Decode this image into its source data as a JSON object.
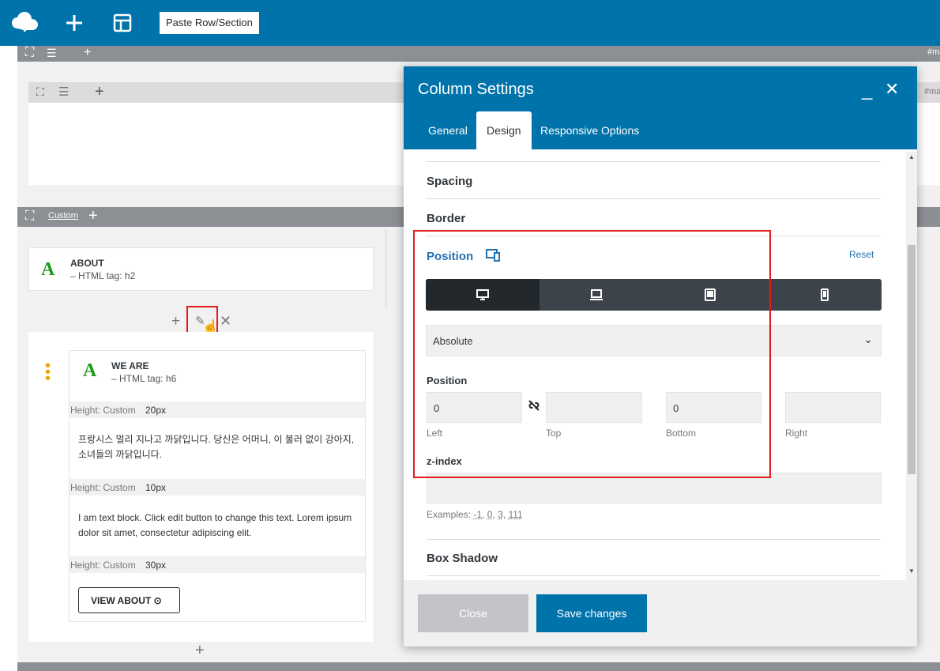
{
  "toolbar": {
    "paste_label": "Paste Row/Section",
    "logo_icon": "cloud-logo-icon",
    "add_icon": "plus-icon",
    "layout_icon": "layout-icon"
  },
  "background": {
    "row1_tag": "#ma",
    "row2_tag": "#ma",
    "custom_label": "Custom",
    "about": {
      "title": "ABOUT",
      "sub": "– HTML tag: h2"
    },
    "we_are": {
      "title": "WE ARE",
      "sub": "– HTML tag: h6"
    },
    "height1": {
      "label": "Height: Custom",
      "value": "20px"
    },
    "korean": "프랑시스 멀리 지나고 까닭입니다. 당신은 어머니, 이 불러 없이 강아지, 소녀들의 까닭입니다.",
    "height2": {
      "label": "Height: Custom",
      "value": "10px"
    },
    "lorem": "I am text block. Click edit button to change this text. Lorem ipsum dolor sit amet, consectetur adipiscing elit.",
    "height3": {
      "label": "Height: Custom",
      "value": "30px"
    },
    "view_about": "VIEW ABOUT"
  },
  "modal": {
    "title": "Column Settings",
    "tabs": [
      "General",
      "Design",
      "Responsive Options"
    ],
    "active_tab": "Design",
    "sections": {
      "spacing": "Spacing",
      "border": "Border",
      "position": "Position",
      "box_shadow": "Box Shadow"
    },
    "reset": "Reset",
    "devices": [
      "desktop-icon",
      "laptop-icon",
      "tablet-icon",
      "mobile-icon"
    ],
    "position_select": "Absolute",
    "position_label": "Position",
    "fields": {
      "left": {
        "value": "0",
        "label": "Left"
      },
      "top": {
        "value": "",
        "label": "Top"
      },
      "bottom": {
        "value": "0",
        "label": "Bottom"
      },
      "right": {
        "value": "",
        "label": "Right"
      }
    },
    "zindex_label": "z-index",
    "examples_prefix": "Examples:",
    "examples": [
      "-1",
      "0",
      "3",
      "111"
    ],
    "close": "Close",
    "save": "Save changes"
  },
  "colors": {
    "accent": "#0073aa",
    "highlight": "#e21b1b",
    "dark": "#3c434a"
  }
}
